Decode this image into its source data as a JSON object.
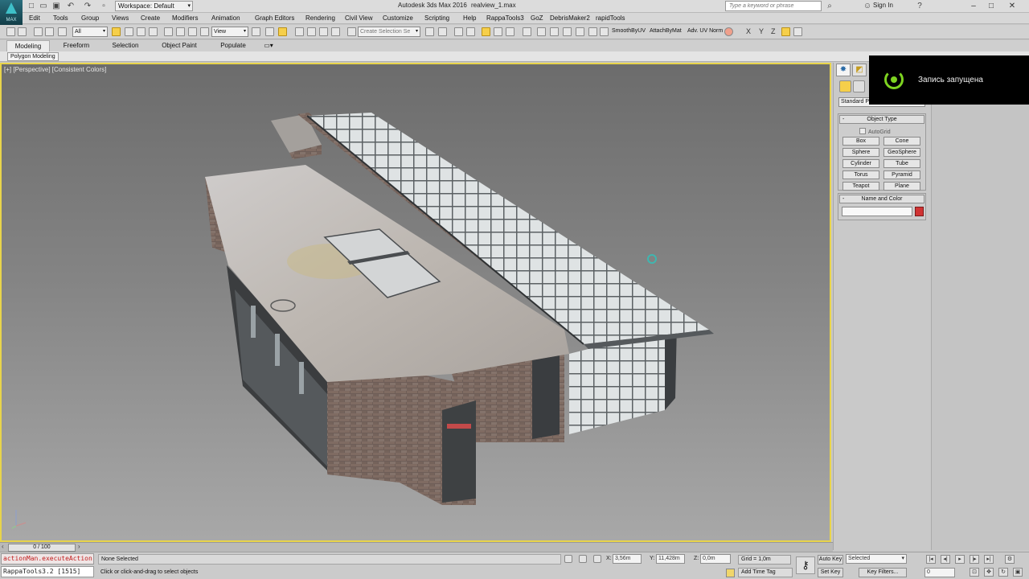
{
  "app": {
    "logo_text": "MAX",
    "title": "Autodesk 3ds Max 2016",
    "file_name": "realview_1.max",
    "workspace": "Workspace: Default",
    "search_placeholder": "Type a keyword or phrase",
    "sign_in": "Sign In"
  },
  "menu": [
    "Edit",
    "Tools",
    "Group",
    "Views",
    "Create",
    "Modifiers",
    "Animation",
    "Graph Editors",
    "Rendering",
    "Civil View",
    "Customize",
    "Scripting",
    "Help",
    "RappaTools3",
    "GoZ",
    "DebrisMaker2",
    "rapidTools"
  ],
  "toolbar": {
    "selection_filter": "All",
    "reference_coord": "View",
    "named_selection_placeholder": "Create Selection Se",
    "script_buttons": [
      "SmoothByUV",
      "AttachByMat",
      "Adv. UV Norm"
    ],
    "axes": [
      "X",
      "Y",
      "Z"
    ]
  },
  "ribbon": {
    "tabs": [
      "Modeling",
      "Freeform",
      "Selection",
      "Object Paint",
      "Populate"
    ],
    "active_tab": "Modeling",
    "subpanel": "Polygon Modeling"
  },
  "viewport": {
    "label": "[+] [Perspective] [Consistent Colors]"
  },
  "command_panel": {
    "category": "Standard P",
    "object_type_title": "Object Type",
    "autogrid_label": "AutoGrid",
    "buttons": [
      "Box",
      "Cone",
      "Sphere",
      "GeoSphere",
      "Cylinder",
      "Tube",
      "Torus",
      "Pyramid",
      "Teapot",
      "Plane"
    ],
    "name_color_title": "Name and Color",
    "object_color": "#d03333"
  },
  "overlay": {
    "recording_text": "Запись запущена",
    "accent": "#7ed321"
  },
  "timeline": {
    "frame_readout": "0 / 100"
  },
  "status": {
    "maxscript_line1": "actionMan.executeAction",
    "maxscript_line2": "RappaTools3.2 [1515]",
    "selection": "None Selected",
    "prompt": "Click or click-and-drag to select objects",
    "x_label": "X:",
    "x_value": "3,56m",
    "y_label": "Y:",
    "y_value": "11,428m",
    "z_label": "Z:",
    "z_value": "0,0m",
    "grid": "Grid = 1,0m",
    "add_time_tag": "Add Time Tag",
    "auto_key": "Auto Key",
    "set_key": "Set Key",
    "key_mode": "Selected",
    "key_filters": "Key Filters...",
    "current_frame": "0"
  }
}
